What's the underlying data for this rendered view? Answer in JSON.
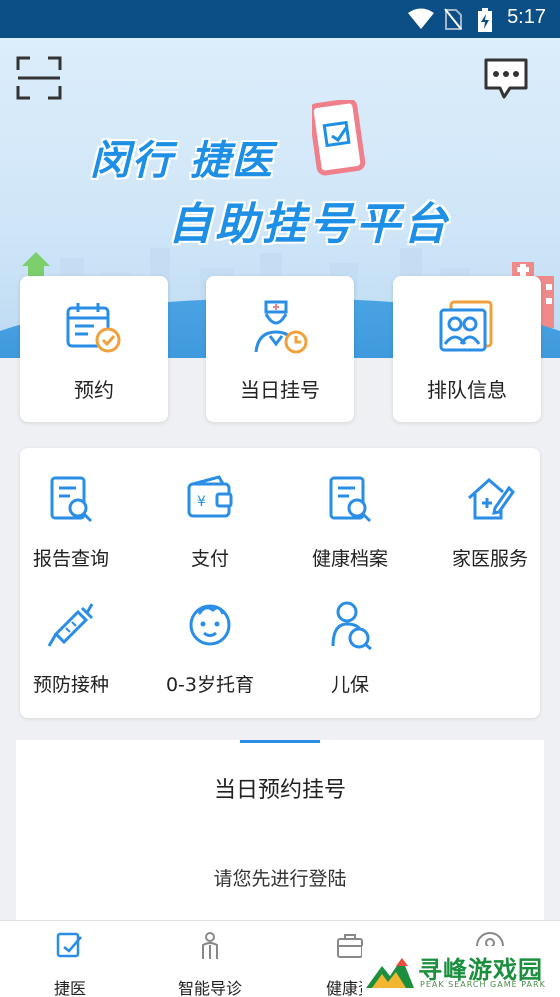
{
  "status_bar": {
    "time": "5:17"
  },
  "banner": {
    "title_line1": "闵行 捷医",
    "title_line2": "自助挂号平台"
  },
  "header": {
    "scan_icon": "scan-icon",
    "message_icon": "message-icon"
  },
  "cards": [
    {
      "label": "预约",
      "icon": "calendar-clock-icon"
    },
    {
      "label": "当日挂号",
      "icon": "doctor-icon"
    },
    {
      "label": "排队信息",
      "icon": "queue-people-icon"
    }
  ],
  "services": [
    {
      "label": "报告查询",
      "icon": "report-search-icon"
    },
    {
      "label": "支付",
      "icon": "wallet-icon"
    },
    {
      "label": "健康档案",
      "icon": "health-record-icon"
    },
    {
      "label": "家医服务",
      "icon": "family-doctor-icon"
    },
    {
      "label": "预防接种",
      "icon": "syringe-icon"
    },
    {
      "label": "0-3岁托育",
      "icon": "baby-icon"
    },
    {
      "label": "儿保",
      "icon": "child-care-icon"
    }
  ],
  "appointment": {
    "title": "当日预约挂号",
    "login_prompt": "请您先进行登陆"
  },
  "bottom_nav": [
    {
      "label": "捷医",
      "icon": "jieyi-icon",
      "active": true
    },
    {
      "label": "智能导诊",
      "icon": "guide-icon",
      "active": false
    },
    {
      "label": "健康资",
      "icon": "health-info-icon",
      "active": false
    },
    {
      "label": "",
      "icon": "profile-icon",
      "active": false
    }
  ],
  "watermark": {
    "text": "寻峰游戏园",
    "subtext": "PEAK SEARCH GAME PARK"
  },
  "colors": {
    "status_bar": "#0b4f86",
    "accent": "#2a8ee6",
    "icon_orange": "#f0a03c"
  }
}
